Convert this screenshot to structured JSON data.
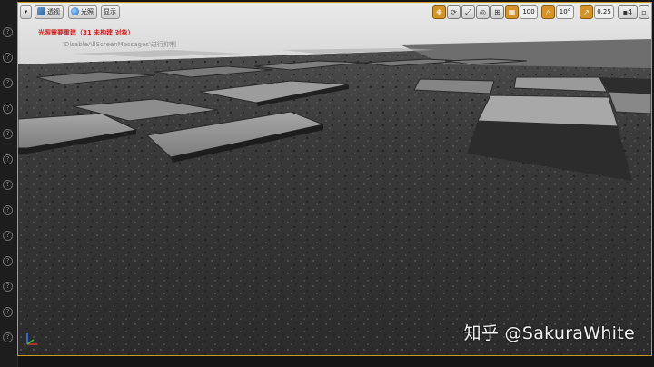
{
  "toolbar": {
    "menu_arrow": "▾",
    "perspective_label": "透视",
    "lit_label": "光照",
    "show_label": "显示",
    "snap_grid_value": "100",
    "snap_rotation_value": "10°",
    "snap_scale_value": "0.25",
    "camera_speed_value": "4"
  },
  "messages": {
    "lighting_rebuild": "光照需要重建（31 未构建 对象）",
    "disable_hint": "'DisableAllScreenMessages'进行抑制"
  },
  "watermark": "知乎 @SakuraWhite",
  "colors": {
    "selection_border": "#c89a1e",
    "warning_text": "#d01f1f",
    "active_snap": "#d6932a"
  }
}
